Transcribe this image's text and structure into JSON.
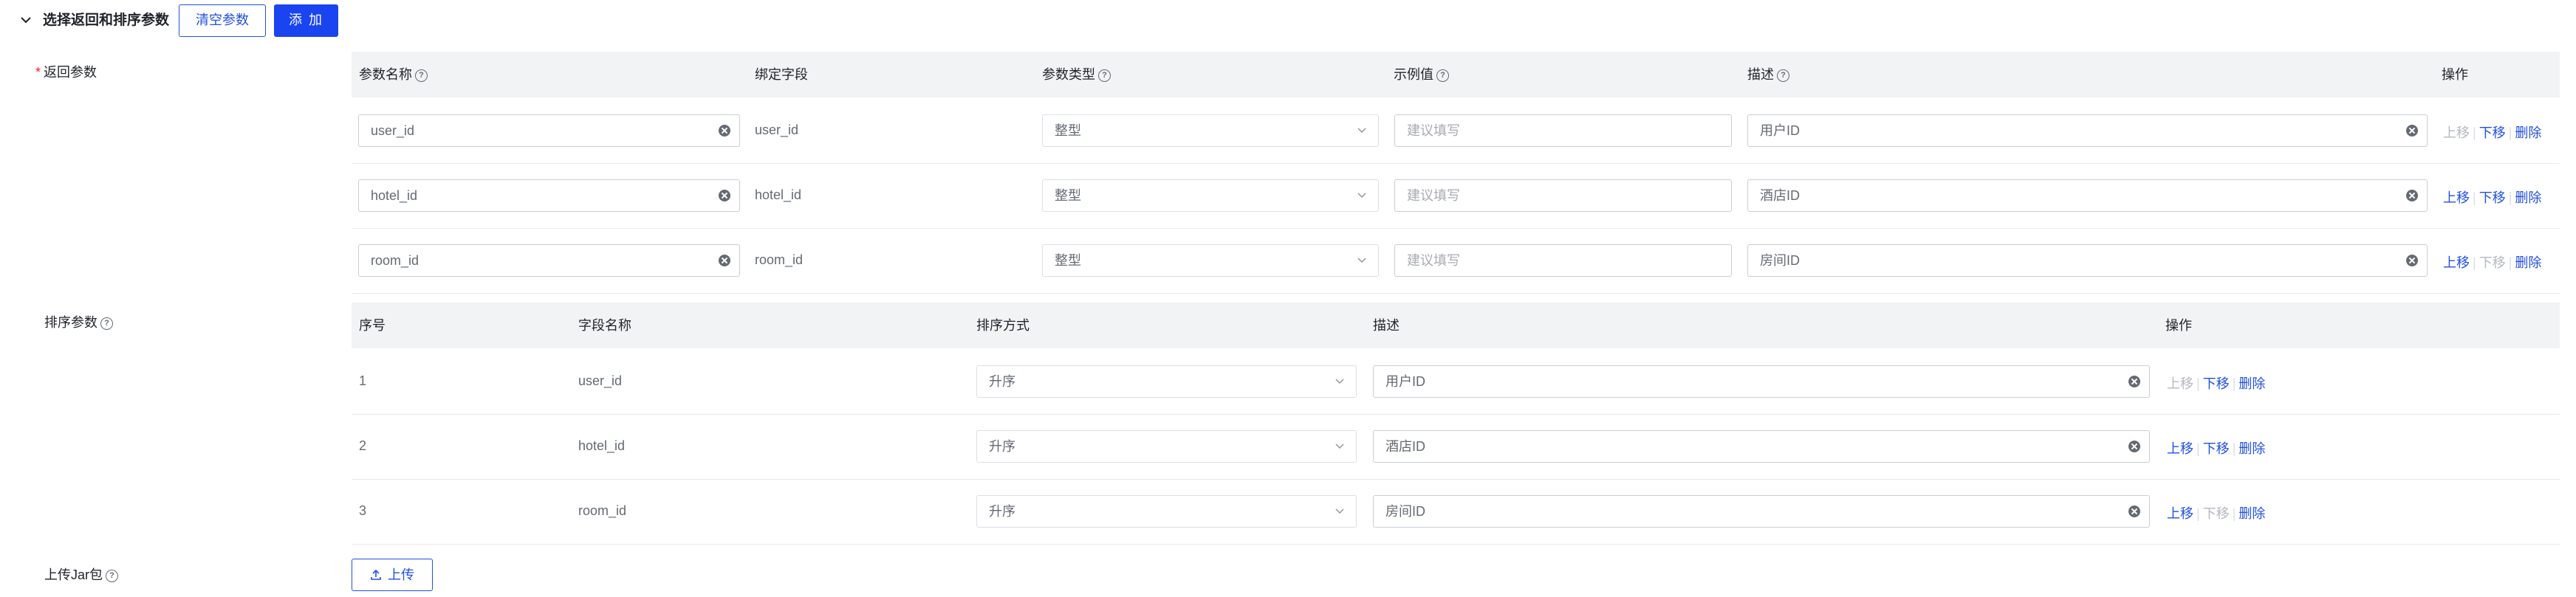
{
  "section": {
    "title": "选择返回和排序参数",
    "clear_label": "清空参数",
    "add_label": "添 加"
  },
  "labels": {
    "return_params": "返回参数",
    "sort_params": "排序参数",
    "upload_jar": "上传Jar包"
  },
  "return_table": {
    "headers": {
      "param_name": "参数名称",
      "bind_field": "绑定字段",
      "param_type": "参数类型",
      "example": "示例值",
      "desc": "描述",
      "ops": "操作"
    },
    "rows": [
      {
        "name": "user_id",
        "field": "user_id",
        "type": "整型",
        "example_placeholder": "建议填写",
        "desc": "用户ID",
        "up_enabled": false,
        "down_enabled": true
      },
      {
        "name": "hotel_id",
        "field": "hotel_id",
        "type": "整型",
        "example_placeholder": "建议填写",
        "desc": "酒店ID",
        "up_enabled": true,
        "down_enabled": true
      },
      {
        "name": "room_id",
        "field": "room_id",
        "type": "整型",
        "example_placeholder": "建议填写",
        "desc": "房间ID",
        "up_enabled": true,
        "down_enabled": false
      }
    ]
  },
  "sort_table": {
    "headers": {
      "index": "序号",
      "field_name": "字段名称",
      "order": "排序方式",
      "desc": "描述",
      "ops": "操作"
    },
    "rows": [
      {
        "index": "1",
        "field": "user_id",
        "order": "升序",
        "desc": "用户ID",
        "up_enabled": false,
        "down_enabled": true
      },
      {
        "index": "2",
        "field": "hotel_id",
        "order": "升序",
        "desc": "酒店ID",
        "up_enabled": true,
        "down_enabled": true
      },
      {
        "index": "3",
        "field": "room_id",
        "order": "升序",
        "desc": "房间ID",
        "up_enabled": true,
        "down_enabled": false
      }
    ]
  },
  "ops": {
    "up": "上移",
    "down": "下移",
    "delete": "删除"
  },
  "upload": {
    "label": "上传",
    "icon": "upload-icon"
  },
  "icons": {
    "caret": "chevron-down-icon",
    "help": "question-circle-icon",
    "clear": "clear-circle-icon",
    "select": "chevron-down-icon"
  },
  "colors": {
    "primary": "#1a44f0",
    "link": "#2250e0",
    "disabled": "#b5b8bf",
    "required": "#f5222d",
    "header_bg": "#f2f3f5"
  }
}
